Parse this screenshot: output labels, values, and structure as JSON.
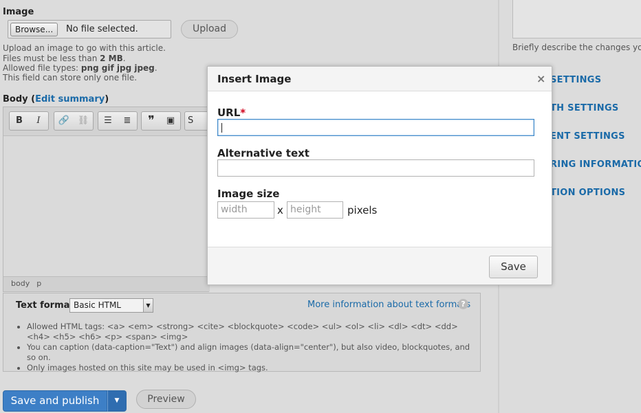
{
  "image_field": {
    "label": "Image",
    "browse_label": "Browse...",
    "file_status": "No file selected.",
    "upload_label": "Upload",
    "help_line1": "Upload an image to go with this article.",
    "help_size_prefix": "Files must be less than ",
    "help_size_value": "2 MB",
    "help_size_suffix": ".",
    "help_types_prefix": "Allowed file types: ",
    "help_types_value": "png gif jpg jpeg",
    "help_types_suffix": ".",
    "help_line4": "This field can store only one file."
  },
  "body_field": {
    "label": "Body",
    "edit_summary_label": "Edit summary",
    "toolbar": {
      "bold": "B",
      "italic": "I",
      "link": "🔗",
      "unlink": "⛓",
      "bullet_list": "☰",
      "numbered_list": "≣",
      "blockquote": "❞",
      "image": "▣",
      "source": "S"
    },
    "path": [
      "body",
      "p"
    ]
  },
  "text_format": {
    "label": "Text format",
    "selected": "Basic HTML",
    "more_info": "More information about text formats",
    "tips": [
      "Allowed HTML tags: <a> <em> <strong> <cite> <blockquote> <code> <ul> <ol> <li> <dl> <dt> <dd> <h4> <h5> <h6> <p> <span> <img>",
      "You can caption (data-caption=\"Text\") and align images (data-align=\"center\"), but also video, blockquotes, and so on.",
      "Only images hosted on this site may be used in <img> tags."
    ]
  },
  "actions": {
    "save_publish": "Save and publish",
    "preview": "Preview"
  },
  "sidebar": {
    "revision_help": "Briefly describe the changes you",
    "links": [
      "SETTINGS",
      "TH SETTINGS",
      "ENT SETTINGS",
      "RING INFORMATION",
      "TION OPTIONS"
    ]
  },
  "dialog": {
    "title": "Insert Image",
    "close": "×",
    "url_label": "URL",
    "required_mark": "*",
    "url_value": "",
    "alt_label": "Alternative text",
    "alt_value": "",
    "size_label": "Image size",
    "width_placeholder": "width",
    "separator": "x",
    "height_placeholder": "height",
    "units": "pixels",
    "save_label": "Save"
  },
  "colors": {
    "accent": "#3d7fc6",
    "link": "#1a6aa8",
    "required": "#d0021b",
    "overlay": "#dcdcdc"
  }
}
